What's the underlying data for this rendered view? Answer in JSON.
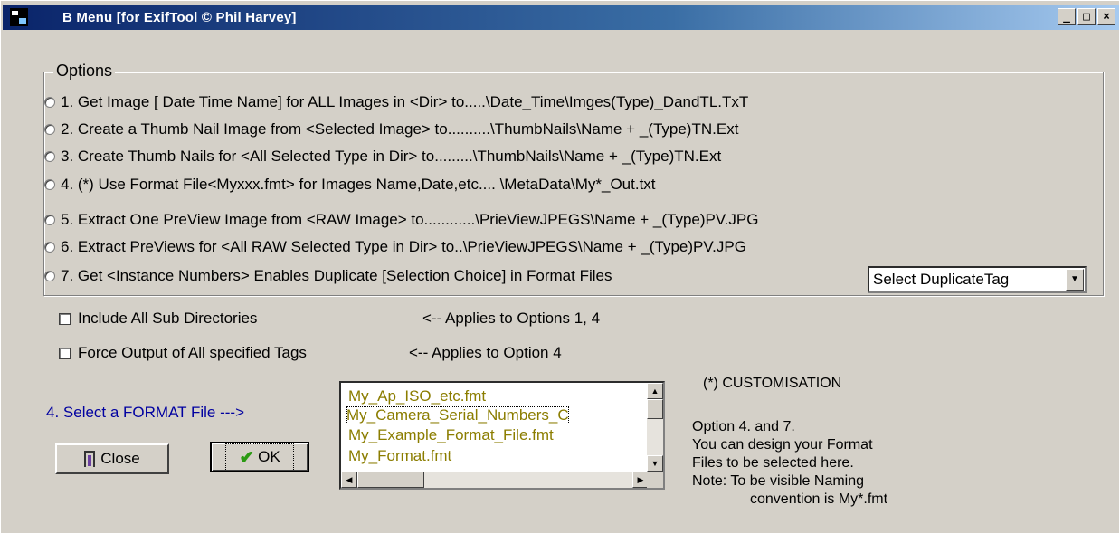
{
  "window": {
    "title": "B Menu  [for ExifTool © Phil Harvey]",
    "caption_buttons": {
      "minimize": "_",
      "maximize": "□",
      "close": "×"
    }
  },
  "options": {
    "legend": "Options",
    "items": [
      "1. Get Image [ Date Time  Name] for ALL Images in <Dir> to.....\\Date_Time\\Imges(Type)_DandTL.TxT",
      "2. Create a Thumb Nail Image from <Selected Image> to..........\\ThumbNails\\Name + _(Type)TN.Ext",
      "3. Create    Thumb Nails for <All Selected Type in Dir> to.........\\ThumbNails\\Name + _(Type)TN.Ext",
      "4.  (*) Use Format File<Myxxx.fmt> for Images Name,Date,etc.... \\MetaData\\My*_Out.txt",
      "5.  Extract One PreView Image from <RAW Image> to............\\PrieViewJPEGS\\Name + _(Type)PV.JPG",
      "6.  Extract PreViews for <All RAW Selected Type in Dir> to..\\PrieViewJPEGS\\Name + _(Type)PV.JPG",
      "7.  Get <Instance Numbers> Enables Duplicate [Selection Choice] in Format Files"
    ],
    "duplicate_combo": "Select DuplicateTag"
  },
  "checkboxes": {
    "sub_dirs": {
      "label": "Include All Sub Directories",
      "note": "<-- Applies to Options 1, 4",
      "checked": false
    },
    "force_output": {
      "label": "Force Output of All specified Tags",
      "note": "<-- Applies to Option  4",
      "checked": false
    }
  },
  "format": {
    "label": "4.  Select a FORMAT File --->",
    "files": [
      "My_Ap_ISO_etc.fmt",
      "My_Camera_Serial_Numbers_C",
      "My_Example_Format_File.fmt",
      "My_Format.fmt"
    ]
  },
  "buttons": {
    "close": "Close",
    "ok": "OK"
  },
  "customisation": {
    "title": "(*) CUSTOMISATION",
    "lines": [
      "Option 4. and 7.",
      "You can design your Format",
      "Files to be selected here.",
      "Note: To be visible Naming",
      "convention is My*.fmt"
    ]
  },
  "colors": {
    "title_bar": "#0a246a",
    "list_text": "#8b7d00",
    "format_label": "#0000a0",
    "face": "#d4d0c8"
  }
}
